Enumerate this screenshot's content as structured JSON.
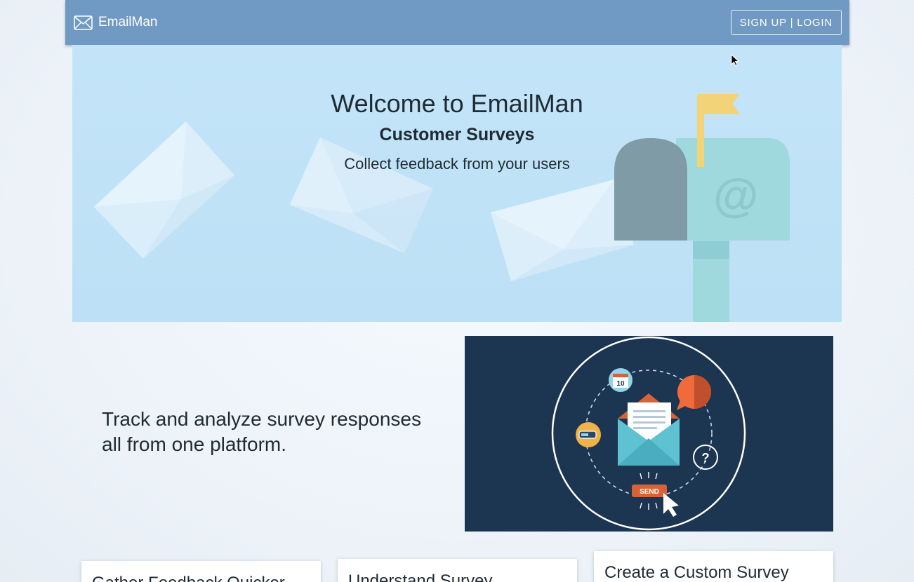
{
  "navbar": {
    "brand": "EmailMan",
    "signup_login": "SIGN UP | LOGIN"
  },
  "hero": {
    "title": "Welcome to EmailMan",
    "subtitle": "Customer Surveys",
    "description": "Collect feedback from your users",
    "mailbox_symbol": "@"
  },
  "feature": {
    "headline": "Track and analyze survey responses all from one platform.",
    "illustration": {
      "calendar_day": "10",
      "send_label": "SEND",
      "question_mark": "?"
    }
  },
  "cards": [
    {
      "title": "Gather Feedback Quicker"
    },
    {
      "title": "Understand Survey"
    },
    {
      "title": "Create a Custom Survey"
    }
  ],
  "colors": {
    "navbar": "#7099c4",
    "hero_bg": "#c3e4f8",
    "illustration_bg": "#1c3551",
    "mailbox_body": "#9fd8dd",
    "mailbox_door": "#7f9ba6",
    "flag": "#f3d377"
  }
}
